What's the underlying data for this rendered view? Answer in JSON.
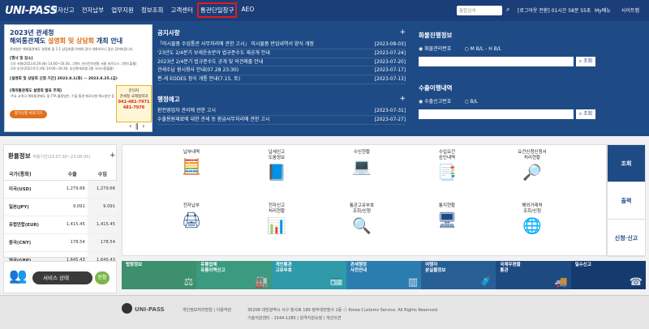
{
  "topbar": {
    "logo": "UNI-PASS",
    "nav": [
      "전자신고",
      "전자납부",
      "업무지원",
      "정보조회",
      "고객센터",
      "통관단일창구",
      "AEO"
    ],
    "search_placeholder": "통합검색",
    "session": "[로그아웃 전환] 01시간 58분 55초",
    "mymenu": "My메뉴",
    "sitemap": "사이트맵"
  },
  "promo": {
    "year": "2023년 관세청",
    "title_a": "해외통관제도 ",
    "title_highlight": "설명회 및 상담회",
    "title_b": " 개최 안내",
    "subtitle": "관세청은 해외통관제도 설명회 및 1:1 상담회를 아래와 같이 개최하오니 많은 참여바랍니다.",
    "sec1_title": "[행사 및 장소]",
    "sec1_lines": [
      "·1차 서울(2023.8.29.(화) 14:00~16:30, 그랜드 인터컨티넨탈 서울 파르나스 그랜드볼룸)",
      "·2차 부산(2023.9.5.(화) 14:00~16:30, 부산롯데호텔 3층 크리스탈볼룸)"
    ],
    "sec2_title": "[설명회 및 상담회 신청 기간] 2023.8.1(화) ~ 2023.8.25.(금)",
    "sec3_title": "[해외통관제도 설명회 발표 주제]",
    "sec3_lines": [
      "·주요 교역국 해외통관제도 및 FTA 활용방안, 수출 통관 애로사항 해소방안 등"
    ],
    "badge_title": "문의처",
    "badge_text": "관세청 국제협력과",
    "badge_phone1": "042-481-7971",
    "badge_phone2": "481-7976",
    "apply_button": "참가신청 바로가기",
    "controls": "‹ ‖ ›"
  },
  "notice": {
    "title": "공지사항",
    "more": "+",
    "items": [
      {
        "title": "「미시물품 수입통관 사무처리에 관한 고시」 미시물품 반입내역서 양식 개정",
        "date": "[2023-08-03]"
      },
      {
        "title": "'23년도 2/4분기 보세운송분야 법규준수도 재공개 안내",
        "date": "[2023-07-24]"
      },
      {
        "title": "2023년 2/4분기 법규준수도 공개 및 의견제출 안내",
        "date": "[2023-07-20]"
      },
      {
        "title": "관세수납 원시청사 안내(07.28 23:30)",
        "date": "[2023-07-17]"
      },
      {
        "title": "편-세 EODES 정식 개통 안내(7.15. 토)",
        "date": "[2023-07-13]"
      }
    ]
  },
  "admin": {
    "title": "행정예고",
    "more": "+",
    "items": [
      {
        "title": "환전영업자 관리에 관한 고시",
        "date": "[2023-07-31]"
      },
      {
        "title": "수출용원재료에 대한 관세 등 환급사무처리에 관한 고시",
        "date": "[2023-07-27]"
      }
    ]
  },
  "cargo": {
    "title": "화물진행정보",
    "radio1": "화물관리번호",
    "radio2": "M B/L - H B/L",
    "button": "조회"
  },
  "export": {
    "title": "수출이행내역",
    "radio1": "수출신고번호",
    "radio2": "B/L",
    "button": "조회"
  },
  "exchange": {
    "title": "환율정보",
    "period": "적용기간(23.07.30~23.08.05)",
    "more": "+",
    "headers": [
      "국가(통화)",
      "수출",
      "수입"
    ],
    "rows": [
      {
        "cur": "미국(USD)",
        "exp": "1,279.66",
        "imp": "1,279.66"
      },
      {
        "cur": "일본(JPY)",
        "exp": "9.091",
        "imp": "9.091"
      },
      {
        "cur": "유럽연합(EUR)",
        "exp": "1,415.45",
        "imp": "1,415.45"
      },
      {
        "cur": "중국(CNY)",
        "exp": "178.54",
        "imp": "178.54"
      },
      {
        "cur": "영국(GBP)",
        "exp": "1,645.43",
        "imp": "1,645.43"
      }
    ]
  },
  "service": {
    "label": "서비스 상태",
    "status": "원활"
  },
  "quick": [
    {
      "label": "납부내역",
      "icon": "calculator-icon"
    },
    {
      "label": "납세신고\n도움정보",
      "icon": "help-book-icon"
    },
    {
      "label": "수신현황",
      "icon": "inbox-computer-icon"
    },
    {
      "label": "수입요건\n승인내역",
      "icon": "approval-document-icon"
    },
    {
      "label": "요건신청신청서\n처리현황",
      "icon": "document-search-icon"
    },
    {
      "label": "전자납부",
      "icon": "payment-terminal-icon"
    },
    {
      "label": "전자신고\n처리현황",
      "icon": "bar-chart-icon"
    },
    {
      "label": "통관고유부호\n조회/신청",
      "icon": "search-person-icon"
    },
    {
      "label": "통지현황",
      "icon": "notification-monitor-icon"
    },
    {
      "label": "해외거래처\n조회/신청",
      "icon": "globe-search-icon"
    }
  ],
  "tabs": [
    "조회",
    "출력",
    "신청·신고"
  ],
  "banners": [
    {
      "label": "법령정보",
      "color": "#3d8f6d",
      "icon": "law-icon"
    },
    {
      "label": "유통업체\n유통이력신고",
      "color": "#3b9a7f",
      "icon": "factory-icon"
    },
    {
      "label": "개인통관\n고유부호",
      "color": "#2f9aa8",
      "icon": "id-card-icon"
    },
    {
      "label": "관세행정\n사전안내",
      "color": "#2b7db0",
      "icon": "barcode-icon"
    },
    {
      "label": "여행자\n분실물정보",
      "color": "#275f95",
      "icon": "luggage-icon"
    },
    {
      "label": "국제우편물\n통관",
      "color": "#1e4a82",
      "icon": "mail-truck-icon"
    },
    {
      "label": "밀수신고",
      "color": "#153a6e",
      "icon": "phone-icon"
    }
  ],
  "footer": {
    "logo": "UNI-PASS",
    "links": "개인정보처리방침 | 이용약관",
    "address": "35208 대전광역시 서구 청사로 189 정부대전청사 1동 ⓒ Korea Customs Service. All Rights Reserved.",
    "tech": "기술지원센터 : 1544-1285 | 원격지원요청 | 개선의견"
  }
}
